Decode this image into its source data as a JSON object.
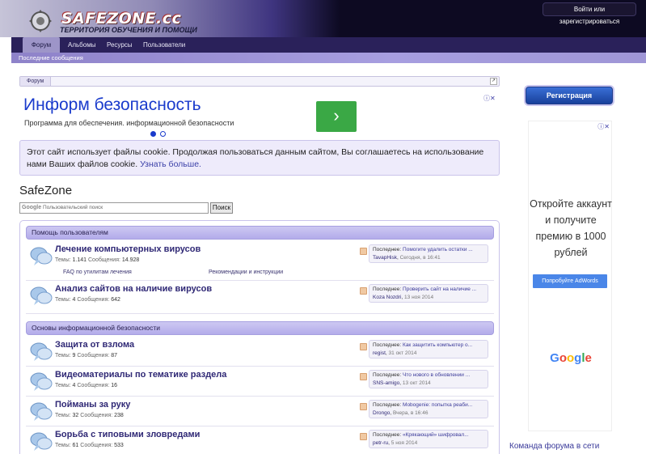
{
  "header": {
    "logo_text": "SAFEZONE.cc",
    "logo_tagline": "ТЕРРИТОРИЯ ОБУЧЕНИЯ И ПОМОЩИ",
    "login_label": "Войти или зарегистрироваться"
  },
  "nav": {
    "tabs": [
      {
        "label": "Форум"
      },
      {
        "label": "Альбомы"
      },
      {
        "label": "Ресурсы"
      },
      {
        "label": "Пользователи"
      }
    ],
    "sub_link": "Последние сообщения"
  },
  "breadcrumb": {
    "item": "Форум",
    "jump_icon": "arrow-jump-icon"
  },
  "ad_top": {
    "title": "Информ безопасность",
    "desc": "Программа для обеспечения. информационной безопасности",
    "btn_glyph": "›"
  },
  "cookie": {
    "text": "Этот сайт использует файлы cookie. Продолжая пользоваться данным сайтом, Вы соглашаетесь на использование нами Ваших файлов cookie.",
    "more": "Узнать больше."
  },
  "forum_title": "SafeZone",
  "search": {
    "google": "Google",
    "placeholder": "Пользовательский поиск",
    "button": "Поиск"
  },
  "categories": [
    {
      "title": "Помощь пользователям",
      "nodes": [
        {
          "title": "Лечение компьютерных вирусов",
          "stats_prefix": "Темы: ",
          "threads": "1.141",
          "stats_mid": " Сообщения: ",
          "posts": "14.928",
          "subforums": [
            "FAQ по утилитам лечения",
            "Рекомендации и инструкции"
          ],
          "last_label": "Последнее: ",
          "last_title": "Помогите удалить остатки ...",
          "last_user": "TavapHisk",
          "last_time": "Сегодня, в 16:41"
        },
        {
          "title": "Анализ сайтов на наличие вирусов",
          "stats_prefix": "Темы: ",
          "threads": "4",
          "stats_mid": " Сообщения: ",
          "posts": "642",
          "last_label": "Последнее: ",
          "last_title": "Проверить сайт на наличие ...",
          "last_user": "Koza Nozdri",
          "last_time": "13 ноя 2014"
        }
      ]
    },
    {
      "title": "Основы информационной безопасности",
      "nodes": [
        {
          "title": "Защита от взлома",
          "stats_prefix": "Темы: ",
          "threads": "9",
          "stats_mid": " Сообщения: ",
          "posts": "87",
          "last_label": "Последнее: ",
          "last_title": "Как защитить компьютер о...",
          "last_user": "regist",
          "last_time": "31 окт 2014"
        },
        {
          "title": "Видеоматериалы по тематике раздела",
          "stats_prefix": "Темы: ",
          "threads": "4",
          "stats_mid": " Сообщения: ",
          "posts": "16",
          "last_label": "Последнее: ",
          "last_title": "Что нового в обновлении ...",
          "last_user": "SNS-amigo",
          "last_time": "13 окт 2014"
        },
        {
          "title": "Пойманы за руку",
          "stats_prefix": "Темы: ",
          "threads": "32",
          "stats_mid": " Сообщения: ",
          "posts": "238",
          "last_label": "Последнее: ",
          "last_title": "Mobogenie: попытка реаби...",
          "last_user": "Drongo",
          "last_time": "Вчера, в 16:46"
        },
        {
          "title": "Борьба с типовыми зловредами",
          "stats_prefix": "Темы: ",
          "threads": "61",
          "stats_mid": " Сообщения: ",
          "posts": "533",
          "last_label": "Последнее: ",
          "last_title": "«Крякающий» шифровал...",
          "last_user": "petr-ru",
          "last_time": "5 ноя 2014"
        }
      ]
    }
  ],
  "sidebar": {
    "register": "Регистрация",
    "ad_text": "Откройте аккаунт и получите премию в 1000 рублей",
    "ad_button": "Попробуйте AdWords",
    "ad_logo": "Google",
    "team_heading": "Команда форума в сети"
  },
  "colors": {
    "accent": "#2a215a",
    "link": "#2f2875",
    "ad_title": "#1a3bcc",
    "ad_button": "#3aa845"
  }
}
